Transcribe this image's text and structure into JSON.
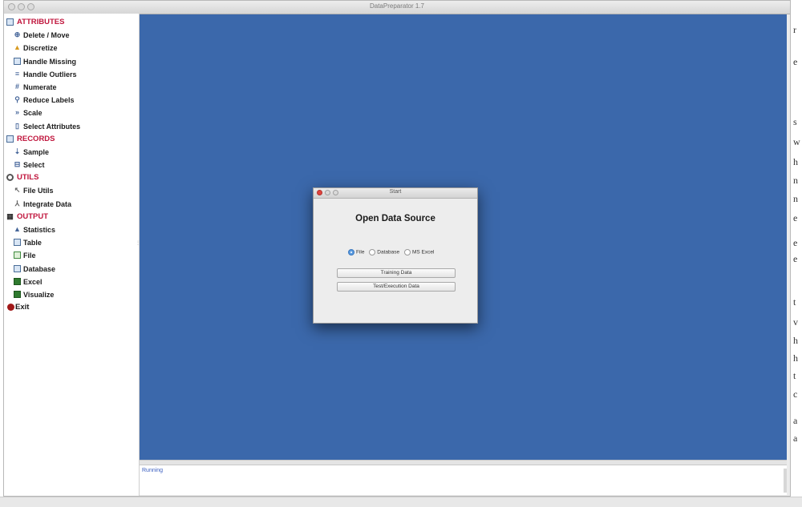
{
  "window": {
    "title": "DataPreparator 1.7"
  },
  "sidebar": {
    "categories": [
      {
        "label": "ATTRIBUTES",
        "items": [
          "Delete / Move",
          "Discretize",
          "Handle Missing",
          "Handle Outliers",
          "Numerate",
          "Reduce Labels",
          "Scale",
          "Select Attributes"
        ]
      },
      {
        "label": "RECORDS",
        "items": [
          "Sample",
          "Select"
        ]
      },
      {
        "label": "UTILS",
        "items": [
          "File Utils",
          "Integrate Data"
        ]
      },
      {
        "label": "OUTPUT",
        "items": [
          "Statistics",
          "Table",
          "File",
          "Database",
          "Excel",
          "Visualize"
        ]
      }
    ],
    "exit": "Exit"
  },
  "dialog": {
    "title": "Start",
    "heading": "Open Data Source",
    "radios": [
      "File",
      "Database",
      "MS Excel"
    ],
    "selected_radio": "File",
    "buttons": [
      "Training Data",
      "Test/Execution Data"
    ]
  },
  "console": {
    "text": "Running"
  },
  "background_fragments": [
    "r",
    "e",
    "s",
    "w",
    "h",
    "n",
    "n",
    "e",
    "e",
    "e",
    "t",
    "v",
    "h",
    "h",
    "t",
    "c",
    "a",
    "a"
  ],
  "colors": {
    "desktop": "#3b68ab",
    "category": "#c0163d",
    "selected_radio": "#5a9be0"
  }
}
